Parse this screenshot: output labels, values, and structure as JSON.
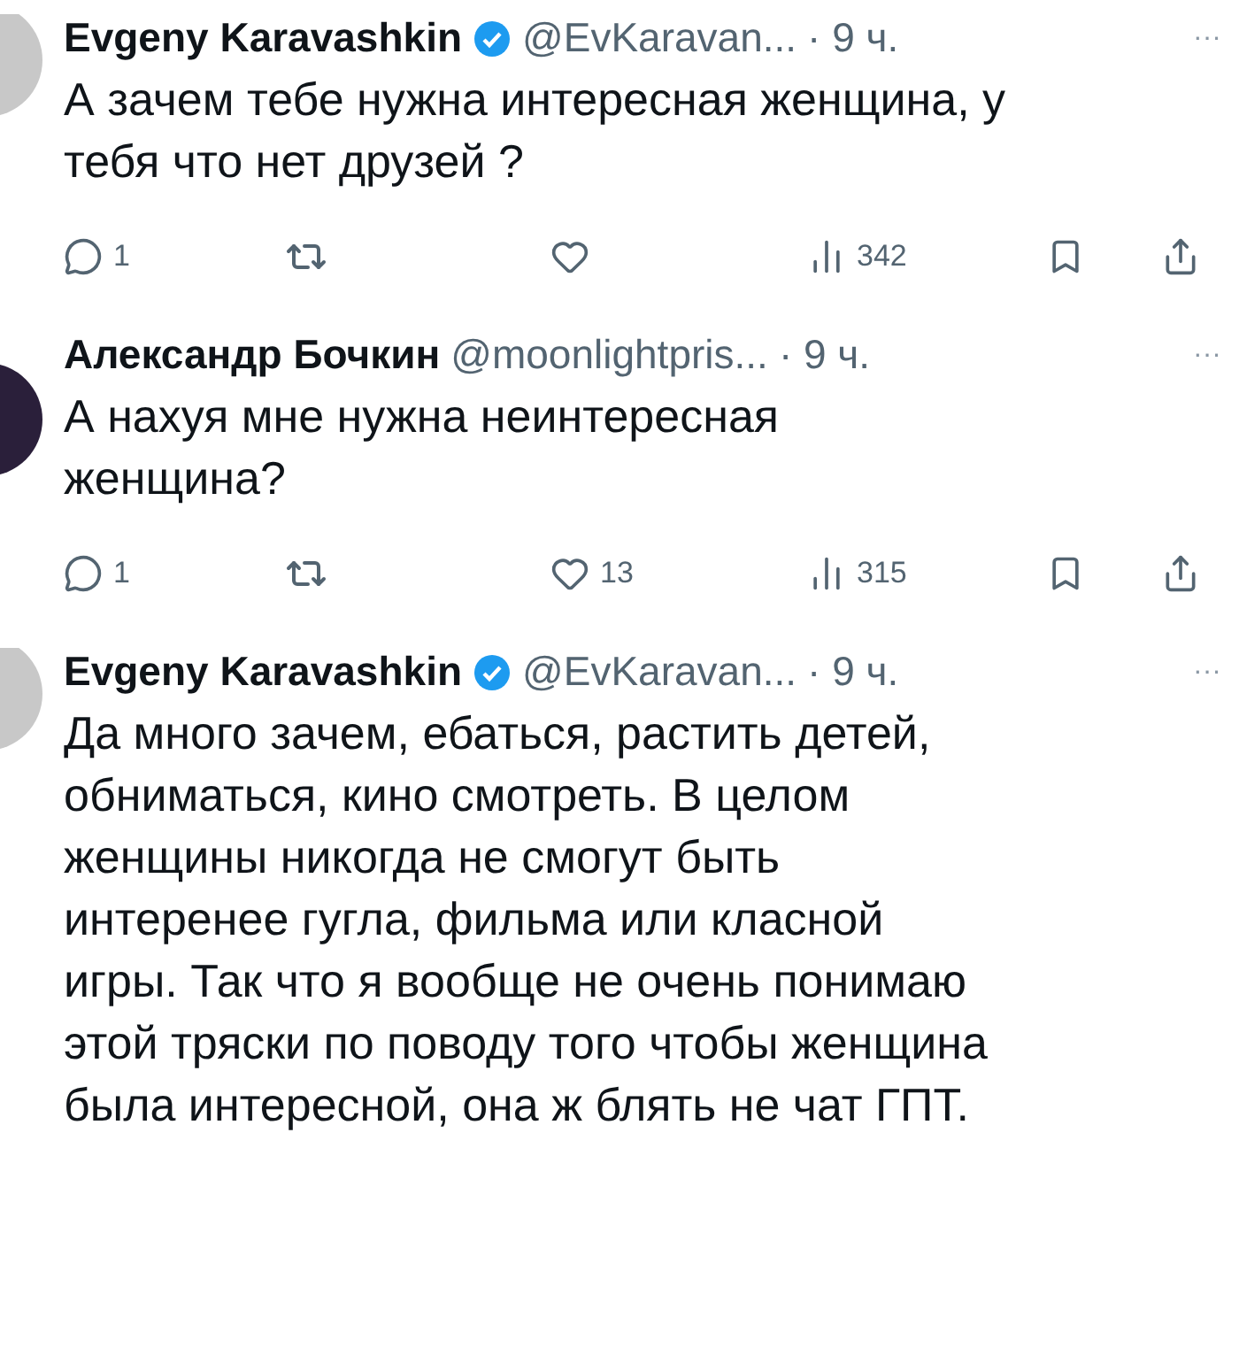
{
  "tweets": [
    {
      "name": "Evgeny Karavashkin",
      "verified": true,
      "color": "#c8c8c8",
      "handle": "@EvKaravan...",
      "time": "· 9 ч.",
      "more": "···",
      "text": [
        "А зачем тебе нужна интересная женщина, у",
        "тебя что нет друзей ?"
      ],
      "replies": "1",
      "views": "342"
    },
    {
      "name": "Александр Бочкин",
      "verified": false,
      "color": "#2a1f3a",
      "handle": "@moonlightpris...",
      "time": "· 9 ч.",
      "more": "···",
      "text": [
        "А нахуя мне нужна неинтересная",
        "женщина?"
      ],
      "replies": "1",
      "likes": "13",
      "views": "315"
    },
    {
      "name": "Evgeny Karavashkin",
      "verified": true,
      "color": "#c8c8c8",
      "handle": "@EvKaravan...",
      "time": "· 9 ч.",
      "more": "···",
      "text": [
        "Да много зачем, ебаться, растить детей,",
        "обниматься, кино смотреть. В целом",
        "женщины никогда не смогут быть",
        "интеренее гугла, фильма или класной",
        "игры.  Так что я вообще не очень понимаю",
        "этой тряски по поводу того чтобы женщина",
        "была интересной, она ж блять не чат ГПТ."
      ]
    }
  ]
}
